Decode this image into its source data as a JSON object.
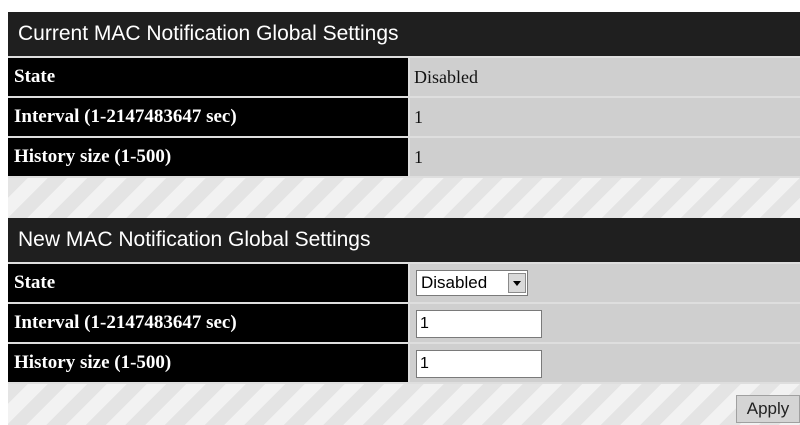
{
  "current_section": {
    "title": "Current MAC Notification Global Settings",
    "rows": [
      {
        "label": "State",
        "value": "Disabled"
      },
      {
        "label": "Interval (1-2147483647 sec)",
        "value": "1"
      },
      {
        "label": "History size (1-500)",
        "value": "1"
      }
    ]
  },
  "new_section": {
    "title": "New MAC Notification Global Settings",
    "state_label": "State",
    "state_value": "Disabled",
    "interval_label": "Interval (1-2147483647 sec)",
    "interval_value": "1",
    "history_label": "History size (1-500)",
    "history_value": "1"
  },
  "apply_label": "Apply",
  "icons": {
    "dropdown": "chevron-down-icon"
  }
}
